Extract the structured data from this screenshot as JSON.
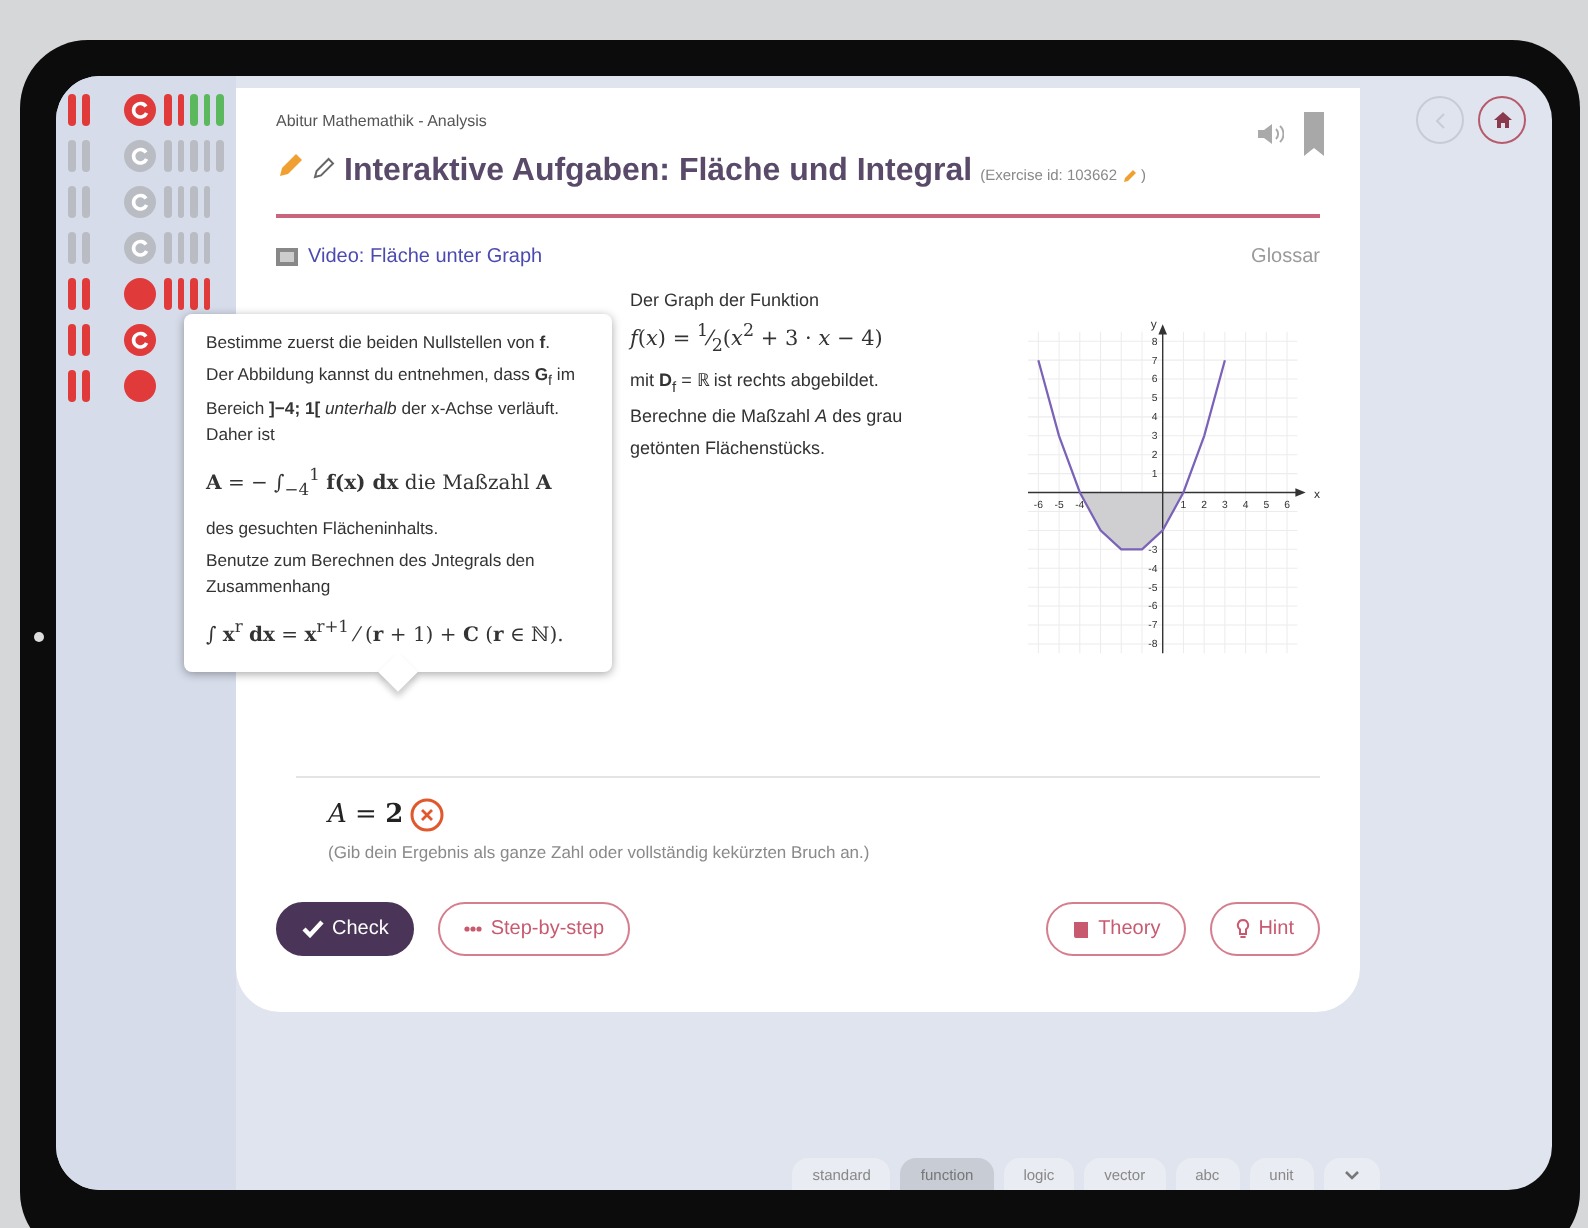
{
  "sidebar": {
    "rows": [
      {
        "kind": "replay",
        "color": "#e03a3a",
        "bars": [
          {
            "color": "#e03a3a"
          },
          {
            "color": "#e03a3a"
          },
          {
            "color": "#5cb85c"
          },
          {
            "color": "#5cb85c"
          },
          {
            "color": "#5cb85c"
          }
        ]
      },
      {
        "kind": "replay",
        "color": "#b9bcc2",
        "bars": [
          {
            "color": "#b9bcc2"
          },
          {
            "color": "#b9bcc2"
          },
          {
            "color": "#b9bcc2"
          },
          {
            "color": "#b9bcc2"
          },
          {
            "color": "#b9bcc2"
          }
        ]
      },
      {
        "kind": "replay",
        "color": "#b9bcc2",
        "bars": [
          {
            "color": "#b9bcc2"
          },
          {
            "color": "#b9bcc2"
          },
          {
            "color": "#b9bcc2"
          },
          {
            "color": "#b9bcc2"
          }
        ]
      },
      {
        "kind": "replay",
        "color": "#b9bcc2",
        "bars": [
          {
            "color": "#b9bcc2"
          },
          {
            "color": "#b9bcc2"
          },
          {
            "color": "#b9bcc2"
          },
          {
            "color": "#b9bcc2"
          }
        ]
      },
      {
        "kind": "dot",
        "color": "#e03a3a",
        "bars": [
          {
            "color": "#e03a3a"
          },
          {
            "color": "#e03a3a"
          },
          {
            "color": "#e03a3a"
          },
          {
            "color": "#e03a3a"
          }
        ]
      },
      {
        "kind": "replay",
        "color": "#e03a3a"
      },
      {
        "kind": "dot",
        "color": "#e03a3a"
      }
    ]
  },
  "exercise": {
    "breadcrumb": "Abitur Mathemathik - Analysis",
    "title": "Interaktive Aufgaben: Fläche und Integral",
    "exercise_id": "(Exercise id: 103662",
    "exercise_id_end": ")",
    "video_link": "Video: Fläche unter Graph",
    "glossary_link": "Glossar",
    "problem": [
      "Der Graph der Funktion",
      "*f*(*x*) = $^{1}$⁄$_{2}$(*x*$^{2}$ + 3 · *x* − 4)",
      "mit **D**$_{f}$ = ℝ ist rechts abgebildet.",
      "Berechne die Maßzahl *A* des grau",
      "getönten Flächenstücks."
    ],
    "chart_data": {
      "type": "line",
      "xlabel": "x",
      "ylabel": "y",
      "x": [
        -6,
        -5,
        -4,
        -3,
        -2,
        -1,
        0,
        1,
        2,
        3
      ],
      "series": [
        {
          "color": "#7a62b8",
          "values": [
            7,
            3,
            0,
            -2,
            -3,
            -3,
            -2,
            0,
            3,
            7
          ]
        }
      ],
      "xlim": [
        -6.5,
        6.8
      ],
      "ylim": [
        -8.5,
        8.8
      ],
      "xticks": [
        -6,
        -5,
        -4,
        1,
        2,
        3,
        4,
        5,
        6
      ],
      "yticks": [
        -8,
        -7,
        -6,
        -5,
        -4,
        -3,
        1,
        2,
        3,
        4,
        5,
        6,
        7,
        8
      ],
      "grid": true
    },
    "answer": {
      "formula": "*A* = **2**",
      "correct": false
    },
    "answer_hint": "(Gib dein Ergebnis als ganze Zahl oder vollständig kekürzten Bruch an.)",
    "buttons": [
      {
        "kind": "check",
        "label": "Check"
      },
      {
        "kind": "steps",
        "label": "Step-by-step"
      },
      {
        "kind": "theory",
        "label": "Theory"
      },
      {
        "kind": "hint",
        "label": "Hint"
      }
    ]
  },
  "tooltip": {
    "paragraphs": [
      "Bestimme zuerst die beiden Nullstellen von **f**.",
      "Der Abbildung kannst du entnehmen, dass **G**$_{f}$ im Bereich **]−4; 1[** *unterhalb* der x-Achse verläuft. Daher ist",
      "**A** = − ∫$_{−4}$$^{1}$ **f(x) dx** die Maßzahl **A**",
      "des gesuchten Flächeninhalts.",
      "Benutze zum Berechnen des Jntegrals den Zusammenhang",
      "∫ **x**$^{r}$ **dx** = **x**$^{r+1}$ ⁄ (**r** + 1) + **C**   (**r** ∈ ℕ)."
    ]
  },
  "keyboard_tabs": [
    {
      "label": "standard",
      "selected": false
    },
    {
      "label": "function",
      "selected": true
    },
    {
      "label": "logic",
      "selected": false
    },
    {
      "label": "vector",
      "selected": false
    },
    {
      "label": "abc",
      "selected": false
    },
    {
      "label": "unit",
      "selected": false
    }
  ]
}
